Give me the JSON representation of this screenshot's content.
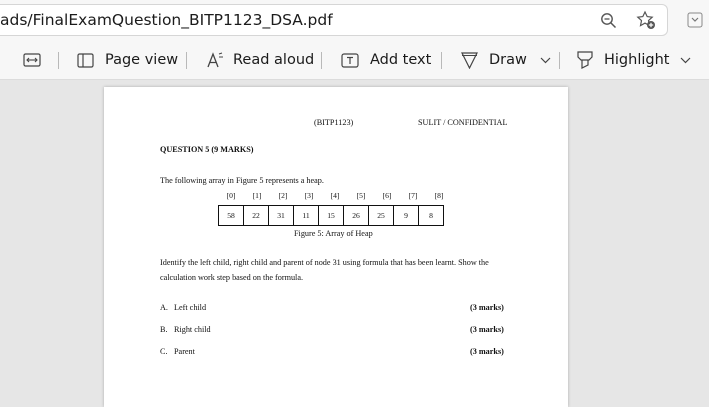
{
  "browser": {
    "url": "ads/FinalExamQuestion_BITP1123_DSA.pdf"
  },
  "toolbar": {
    "page_view": "Page view",
    "read_aloud": "Read aloud",
    "add_text": "Add text",
    "draw": "Draw",
    "highlight": "Highlight"
  },
  "document": {
    "course_code": "(BITP1123)",
    "classification": "SULIT / CONFIDENTIAL",
    "question_title": "QUESTION 5 (9 MARKS)",
    "intro": "The following array in Figure 5 represents a heap.",
    "array_indices": [
      "[0]",
      "[1]",
      "[2]",
      "[3]",
      "[4]",
      "[5]",
      "[6]",
      "[7]",
      "[8]"
    ],
    "array_values": [
      "58",
      "22",
      "31",
      "11",
      "15",
      "26",
      "25",
      "9",
      "8"
    ],
    "figure_caption": "Figure 5: Array of Heap",
    "instruction_line1": "Identify the left child, right child and parent of node 31 using formula that has been learnt. Show the",
    "instruction_line2": "calculation work step based on the formula.",
    "parts": [
      {
        "label": "A.",
        "text": "Left child",
        "marks": "(3 marks)"
      },
      {
        "label": "B.",
        "text": "Right child",
        "marks": "(3 marks)"
      },
      {
        "label": "C.",
        "text": "Parent",
        "marks": "(3 marks)"
      }
    ]
  }
}
